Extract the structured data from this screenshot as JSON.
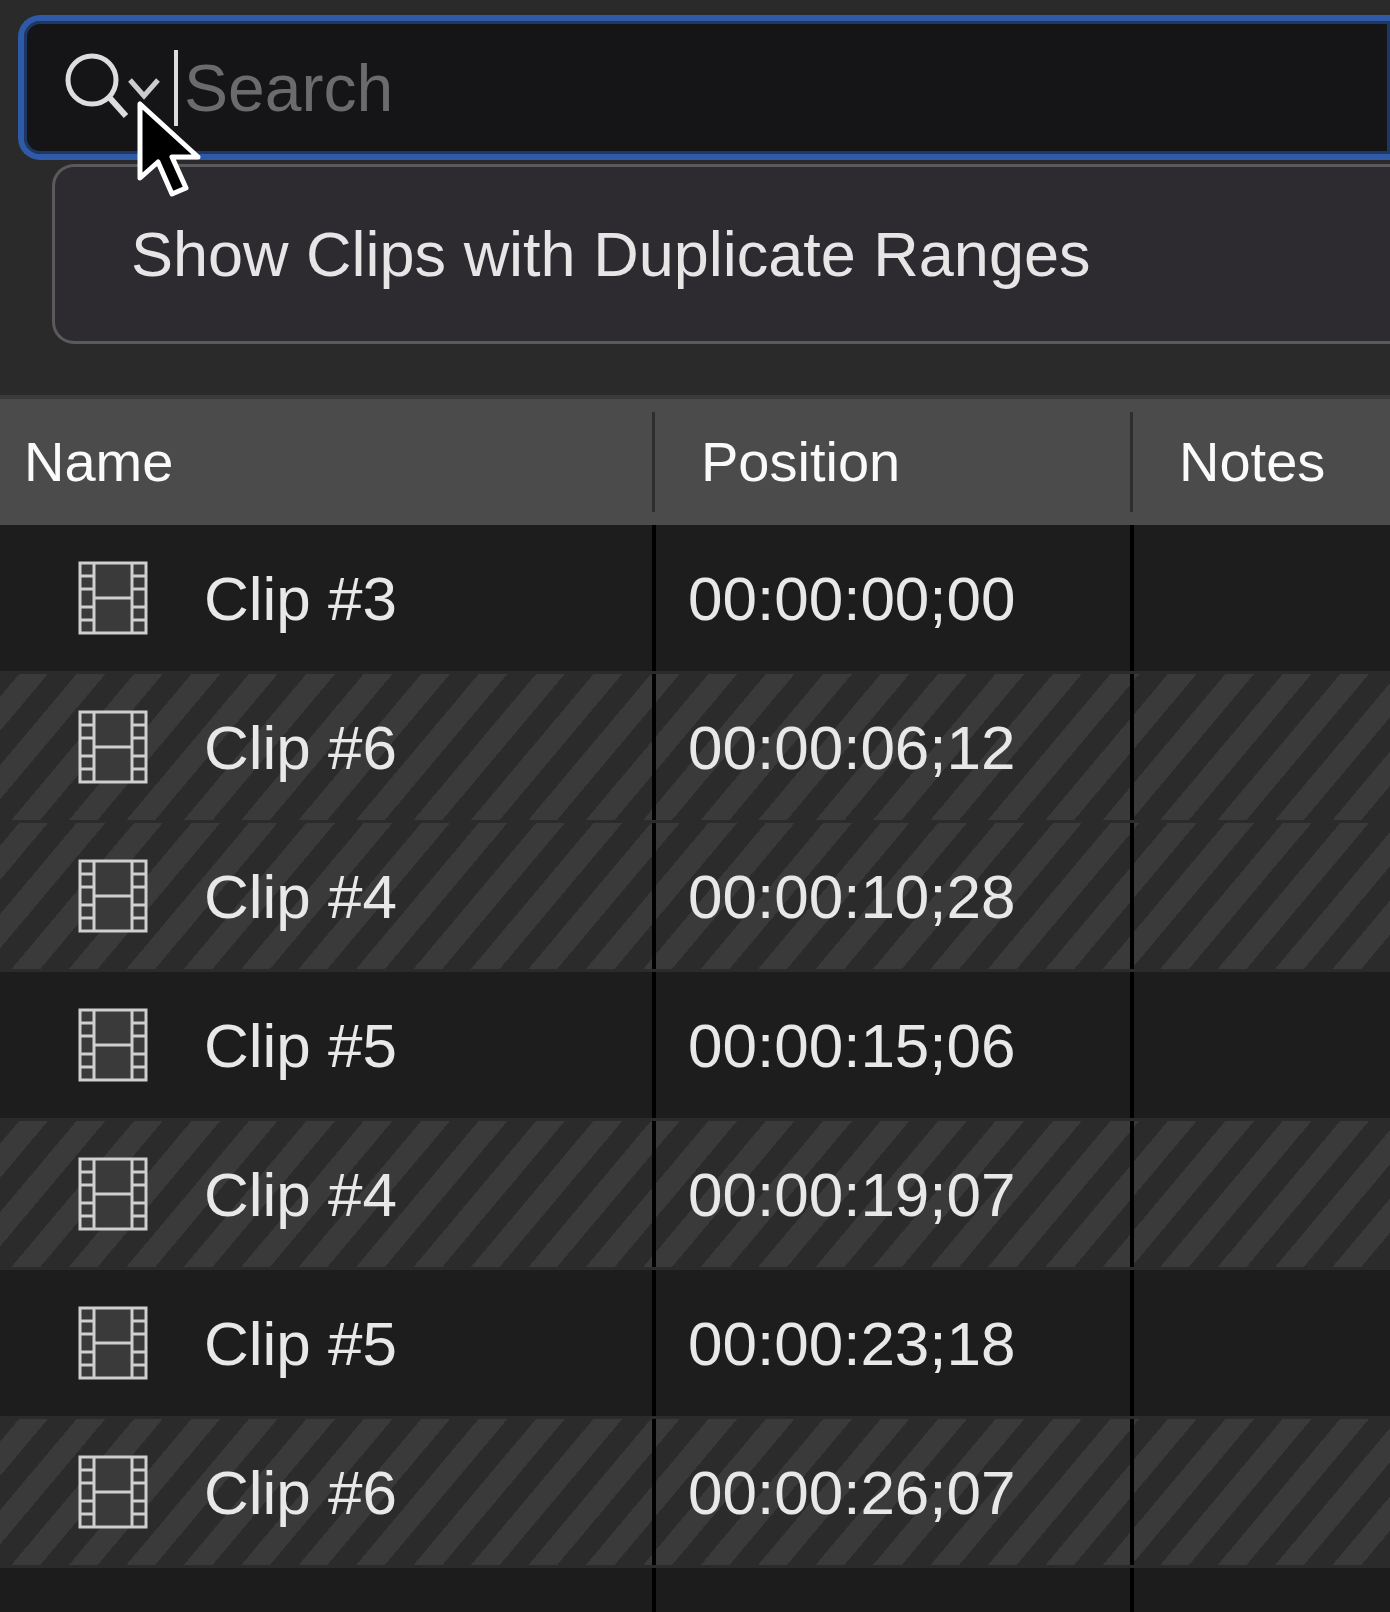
{
  "search": {
    "placeholder": "Search",
    "focused": true
  },
  "tooltip": {
    "text": "Show Clips with Duplicate Ranges"
  },
  "table": {
    "columns": [
      "Name",
      "Position",
      "Notes"
    ],
    "rows": [
      {
        "name": "Clip #3",
        "position": "00:00:00;00",
        "duplicate": false
      },
      {
        "name": "Clip #6",
        "position": "00:00:06;12",
        "duplicate": true
      },
      {
        "name": "Clip #4",
        "position": "00:00:10;28",
        "duplicate": true
      },
      {
        "name": "Clip #5",
        "position": "00:00:15;06",
        "duplicate": false
      },
      {
        "name": "Clip #4",
        "position": "00:00:19;07",
        "duplicate": true
      },
      {
        "name": "Clip #5",
        "position": "00:00:23;18",
        "duplicate": false
      },
      {
        "name": "Clip #6",
        "position": "00:00:26;07",
        "duplicate": true
      }
    ]
  }
}
